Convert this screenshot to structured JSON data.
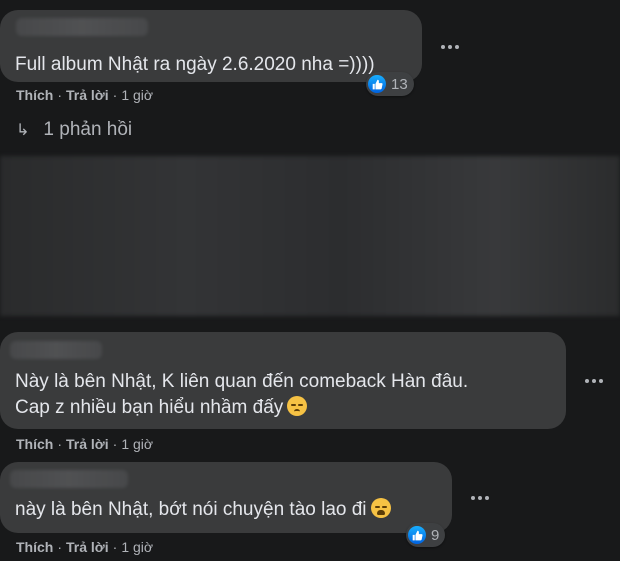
{
  "comments": [
    {
      "text": "Full album Nhật ra ngày 2.6.2020 nha =))))",
      "reaction_count": "13",
      "actions": {
        "like": "Thích",
        "reply": "Trả lời",
        "time": "1 giờ"
      },
      "replies_link": "1 phản hồi"
    },
    {
      "text_line1": "Này là bên Nhật, K liên quan đến comeback Hàn đâu.",
      "text_line2": "Cap z nhiều bạn hiểu nhầm đấy",
      "actions": {
        "like": "Thích",
        "reply": "Trả lời",
        "time": "1 giờ"
      }
    },
    {
      "text": "này là bên Nhật, bớt nói chuyện tào lao đi",
      "reaction_count": "9",
      "actions": {
        "like": "Thích",
        "reply": "Trả lời",
        "time": "1 giờ"
      }
    }
  ],
  "separator": "·",
  "colors": {
    "background": "#18191a",
    "bubble": "#3a3b3c",
    "text": "#e4e6eb",
    "secondary_text": "#b0b3b8",
    "like_blue": "#0062df"
  },
  "icons": [
    "more-options-icon",
    "like-reaction-icon",
    "reply-arrow-icon",
    "pensive-face-emoji",
    "pleading-face-emoji"
  ]
}
